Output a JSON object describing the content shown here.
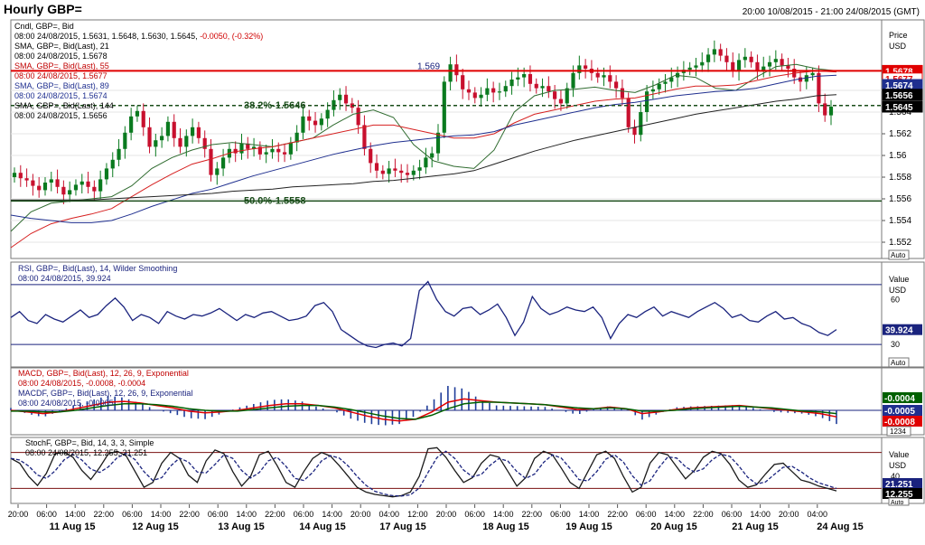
{
  "window": {
    "title": "Hourly GBP=",
    "time_range": "20:00 10/08/2015 - 21:00 24/08/2015 (GMT)"
  },
  "colors": {
    "candle_up": "#0a7a1f",
    "candle_down": "#c8102e",
    "sma21": "#2f6b2f",
    "sma55": "#d62020",
    "sma89": "#1f2f8f",
    "sma144": "#222222",
    "rsi": "#1a237e",
    "macd": "#e00000",
    "macdf": "#006000",
    "hist": "#1f3d99",
    "stoch_k": "#1a1a1a",
    "stoch_d": "#1a237e",
    "resistance": "#e00000"
  },
  "price_panel": {
    "legend": [
      {
        "text": "Cndl, GBP=, Bid",
        "color": "#000000"
      },
      {
        "text": "08:00 24/08/2015, 1.5631, 1.5648, 1.5630, 1.5645, ",
        "color": "#000000",
        "extra": "-0.0050, (-0.32%)",
        "extra_color": "#d00000"
      },
      {
        "text": "SMA, GBP=, Bid(Last), 21",
        "color": "#000000"
      },
      {
        "text": "08:00 24/08/2015, 1.5678",
        "color": "#000000"
      },
      {
        "text": "SMA, GBP=, Bid(Last), 55",
        "color": "#c00000"
      },
      {
        "text": "08:00 24/08/2015, 1.5677",
        "color": "#c00000"
      },
      {
        "text": "SMA, GBP=, Bid(Last), 89",
        "color": "#1f2f8f"
      },
      {
        "text": "08:00 24/08/2015, 1.5674",
        "color": "#1f2f8f"
      },
      {
        "text": "SMA, GBP=, Bid(Last), 144",
        "color": "#000000"
      },
      {
        "text": "08:00 24/08/2015, 1.5656",
        "color": "#000000"
      }
    ],
    "axis_header": [
      "Price",
      "USD"
    ],
    "ticks": [
      "1.566",
      "1.564",
      "1.562",
      "1.56",
      "1.558",
      "1.556",
      "1.554",
      "1.552"
    ],
    "ylim": [
      1.5505,
      1.5725
    ],
    "resistance": {
      "value": 1.5678,
      "label": "1.569"
    },
    "fib_382": {
      "value": 1.5646,
      "label": "38.2%-1.5646"
    },
    "fib_500": {
      "value": 1.5558,
      "label": "50.0%-1.5558"
    },
    "value_labels": [
      {
        "text": "1.5678",
        "value": 1.5678,
        "bg": "#e00000",
        "fg": "#ffffff"
      },
      {
        "text": "1.5677",
        "value": 1.5671,
        "bg": "#ffffff",
        "fg": "#e00000"
      },
      {
        "text": "1.5674",
        "value": 1.5665,
        "bg": "#1f2f8f",
        "fg": "#ffffff"
      },
      {
        "text": "1.5656",
        "value": 1.5656,
        "bg": "#000000",
        "fg": "#ffffff"
      },
      {
        "text": "1.5645",
        "value": 1.5645,
        "bg": "#000000",
        "fg": "#ffffff"
      }
    ],
    "auto": "Auto"
  },
  "rsi_panel": {
    "legend": [
      {
        "text": "RSI, GBP=, Bid(Last), 14, Wilder Smoothing",
        "color": "#1a237e"
      },
      {
        "text": "08:00 24/08/2015, 39.924",
        "color": "#1a237e"
      }
    ],
    "axis_header": [
      "Value",
      "USD"
    ],
    "ticks": [
      "60",
      "30"
    ],
    "ylim": [
      15,
      85
    ],
    "levels": [
      70,
      30
    ],
    "value_label": {
      "text": "39.924",
      "value": 39.924
    },
    "auto": "Auto"
  },
  "macd_panel": {
    "legend": [
      {
        "text": "MACD, GBP=, Bid(Last), 12, 26, 9, Exponential",
        "color": "#c00000"
      },
      {
        "text": "08:00 24/08/2015, -0.0008, -0.0004",
        "color": "#c00000"
      },
      {
        "text": "MACDF, GBP=, Bid(Last), 12, 26, 9, Exponential",
        "color": "#1a237e"
      },
      {
        "text": "08:00 24/08/2015, -0.0005",
        "color": "#1a237e"
      }
    ],
    "value_labels": [
      {
        "text": "-0.0004",
        "bg": "#006000",
        "fg": "#ffffff"
      },
      {
        "text": "-0.0005",
        "bg": "#1f2f8f",
        "fg": "#ffffff"
      },
      {
        "text": "-0.0008",
        "bg": "#e00000",
        "fg": "#ffffff"
      }
    ],
    "scale": "1234"
  },
  "stoch_panel": {
    "legend": [
      {
        "text": "StochF, GBP=, Bid, 14, 3, 3, Simple",
        "color": "#000000"
      },
      {
        "text": "08:00 24/08/2015, 12.255, 21.251",
        "color": "#000000"
      }
    ],
    "axis_header": [
      "Value",
      "USD"
    ],
    "ticks": [
      "40"
    ],
    "ylim": [
      -5,
      105
    ],
    "levels": [
      80,
      20
    ],
    "value_labels": [
      {
        "text": "21.251",
        "bg": "#1a237e",
        "fg": "#ffffff"
      },
      {
        "text": "12.255",
        "bg": "#000000",
        "fg": "#ffffff"
      }
    ],
    "auto": "Auto"
  },
  "x_axis": {
    "time_ticks": [
      "20:00",
      "06:00",
      "14:00",
      "22:00",
      "06:00",
      "14:00",
      "22:00",
      "06:00",
      "14:00",
      "22:00",
      "06:00",
      "14:00",
      "20:00",
      "04:00",
      "12:00",
      "20:00",
      "06:00",
      "14:00",
      "22:00",
      "06:00",
      "14:00",
      "22:00",
      "06:00",
      "14:00",
      "22:00",
      "06:00",
      "14:00",
      "20:00",
      "04:00"
    ],
    "date_labels": [
      "11 Aug 15",
      "12 Aug 15",
      "13 Aug 15",
      "14 Aug 15",
      "17 Aug 15",
      "18 Aug 15",
      "19 Aug 15",
      "20 Aug 15",
      "21 Aug 15",
      "24 Aug 15"
    ]
  },
  "chart_data": {
    "type": "line",
    "title": "Hourly GBP=",
    "series": [
      {
        "name": "Cndl, GBP=, Bid",
        "kind": "candlestick",
        "close": [
          1.5584,
          1.5579,
          1.5577,
          1.5572,
          1.5568,
          1.5575,
          1.5578,
          1.5571,
          1.5564,
          1.5568,
          1.5573,
          1.5576,
          1.5571,
          1.5567,
          1.5578,
          1.5588,
          1.5596,
          1.5606,
          1.5621,
          1.5636,
          1.5641,
          1.5626,
          1.5608,
          1.5614,
          1.5618,
          1.5631,
          1.5616,
          1.5608,
          1.5618,
          1.5626,
          1.5616,
          1.5606,
          1.5582,
          1.5588,
          1.5598,
          1.5606,
          1.5602,
          1.5611,
          1.5606,
          1.5608,
          1.5601,
          1.5603,
          1.5606,
          1.5603,
          1.5601,
          1.5612,
          1.5621,
          1.5636,
          1.5632,
          1.5628,
          1.5634,
          1.5642,
          1.5651,
          1.5656,
          1.5648,
          1.5644,
          1.5628,
          1.5606,
          1.5593,
          1.5586,
          1.5583,
          1.5588,
          1.5586,
          1.5584,
          1.5582,
          1.5586,
          1.5589,
          1.5598,
          1.5602,
          1.5621,
          1.5668,
          1.5684,
          1.5674,
          1.5661,
          1.5658,
          1.5653,
          1.5656,
          1.5662,
          1.5658,
          1.5659,
          1.5664,
          1.567,
          1.5672,
          1.5675,
          1.5666,
          1.5662,
          1.5664,
          1.5659,
          1.5652,
          1.5648,
          1.5662,
          1.5676,
          1.5683,
          1.568,
          1.5676,
          1.5672,
          1.5674,
          1.5668,
          1.5662,
          1.5653,
          1.5626,
          1.5619,
          1.564,
          1.5659,
          1.5661,
          1.5666,
          1.5668,
          1.5672,
          1.5676,
          1.5679,
          1.5681,
          1.5683,
          1.5686,
          1.5693,
          1.5698,
          1.5692,
          1.5686,
          1.5678,
          1.5688,
          1.5691,
          1.5686,
          1.5678,
          1.5682,
          1.5686,
          1.5689,
          1.5683,
          1.568,
          1.5672,
          1.5668,
          1.5674,
          1.5676,
          1.5648,
          1.5637,
          1.5645
        ]
      },
      {
        "name": "SMA, GBP=, Bid(Last), 21",
        "values": [
          1.553,
          1.5548,
          1.5556,
          1.5558,
          1.556,
          1.5562,
          1.5572,
          1.5588,
          1.5598,
          1.5605,
          1.561,
          1.5612,
          1.561,
          1.5608,
          1.5612,
          1.5616,
          1.5628,
          1.5638,
          1.5642,
          1.5635,
          1.561,
          1.5595,
          1.559,
          1.5588,
          1.5605,
          1.564,
          1.5655,
          1.566,
          1.5661,
          1.5663,
          1.566,
          1.5658,
          1.5665,
          1.5674,
          1.5672,
          1.5662,
          1.566,
          1.5672,
          1.5682,
          1.5684,
          1.568,
          1.5678
        ]
      },
      {
        "name": "SMA, GBP=, Bid(Last), 55",
        "values": [
          1.5515,
          1.5528,
          1.5537,
          1.5542,
          1.5546,
          1.5551,
          1.5562,
          1.5573,
          1.5583,
          1.5592,
          1.5597,
          1.5603,
          1.5606,
          1.5608,
          1.5612,
          1.5616,
          1.562,
          1.5624,
          1.5628,
          1.5628,
          1.5624,
          1.562,
          1.5616,
          1.5616,
          1.562,
          1.563,
          1.5638,
          1.5642,
          1.5646,
          1.565,
          1.5652,
          1.5653,
          1.5657,
          1.5661,
          1.5664,
          1.5664,
          1.5665,
          1.5669,
          1.5673,
          1.5676,
          1.5678,
          1.5677
        ]
      },
      {
        "name": "SMA, GBP=, Bid(Last), 89",
        "values": [
          1.5545,
          1.5542,
          1.554,
          1.5538,
          1.5538,
          1.554,
          1.5546,
          1.5553,
          1.5559,
          1.5565,
          1.5569,
          1.5575,
          1.5581,
          1.5586,
          1.5591,
          1.5596,
          1.5601,
          1.5605,
          1.5609,
          1.5612,
          1.5614,
          1.5616,
          1.5618,
          1.5619,
          1.5622,
          1.5628,
          1.5632,
          1.5636,
          1.564,
          1.5644,
          1.5647,
          1.5649,
          1.5652,
          1.5655,
          1.5657,
          1.5659,
          1.566,
          1.5662,
          1.5666,
          1.567,
          1.5673,
          1.5674
        ]
      },
      {
        "name": "SMA, GBP=, Bid(Last), 144",
        "values": [
          1.5559,
          1.5559,
          1.5559,
          1.5559,
          1.5559,
          1.556,
          1.5561,
          1.5562,
          1.5563,
          1.5564,
          1.5565,
          1.5567,
          1.5568,
          1.5569,
          1.5571,
          1.5572,
          1.5573,
          1.5574,
          1.5576,
          1.5577,
          1.5579,
          1.5581,
          1.5583,
          1.5586,
          1.5592,
          1.5598,
          1.5604,
          1.5609,
          1.5614,
          1.5618,
          1.5622,
          1.5626,
          1.563,
          1.5634,
          1.5638,
          1.5641,
          1.5644,
          1.5647,
          1.565,
          1.5652,
          1.5655,
          1.5656
        ]
      },
      {
        "name": "RSI, GBP=, Bid(Last), 14, Wilder Smoothing",
        "values": [
          48,
          52,
          46,
          44,
          50,
          47,
          45,
          49,
          53,
          48,
          50,
          56,
          61,
          55,
          46,
          50,
          48,
          44,
          52,
          49,
          47,
          50,
          49,
          51,
          54,
          50,
          46,
          50,
          48,
          51,
          52,
          49,
          46,
          47,
          49,
          56,
          58,
          52,
          40,
          36,
          32,
          29,
          28,
          30,
          31,
          29,
          34,
          66,
          72,
          60,
          52,
          49,
          54,
          55,
          50,
          53,
          57,
          48,
          36,
          45,
          62,
          54,
          50,
          52,
          55,
          53,
          52,
          55,
          48,
          34,
          44,
          50,
          48,
          52,
          55,
          49,
          52,
          50,
          48,
          52,
          55,
          58,
          54,
          48,
          50,
          46,
          45,
          49,
          52,
          47,
          48,
          44,
          42,
          38,
          36,
          40
        ]
      },
      {
        "name": "MACD, GBP=, Bid(Last), 12, 26, 9, Exponential",
        "values": [
          0.0,
          -0.0002,
          -0.0004,
          -0.0002,
          0.0002,
          0.0006,
          0.001,
          0.0011,
          0.0009,
          0.0006,
          0.0003,
          -0.0001,
          -0.0003,
          -0.0002,
          0.0,
          0.0003,
          0.0006,
          0.0008,
          0.0008,
          0.0006,
          0.0003,
          -0.0002,
          -0.0007,
          -0.0011,
          -0.0013,
          -0.0011,
          -0.0002,
          0.001,
          0.0014,
          0.0012,
          0.001,
          0.0009,
          0.0008,
          0.0007,
          0.0004,
          0.0001,
          0.0002,
          0.0004,
          0.0002,
          -0.0004,
          -0.0002,
          0.0001,
          0.0003,
          0.0004,
          0.0005,
          0.0006,
          0.0004,
          0.0002,
          0.0,
          -0.0002,
          -0.0004,
          -0.0008
        ]
      },
      {
        "name": "MACDF, GBP=, Bid(Last), 12, 26, 9, Exponential",
        "values": [
          -0.0001,
          -0.0001,
          -0.0002,
          -0.0002,
          0.0,
          0.0003,
          0.0006,
          0.0008,
          0.0008,
          0.0007,
          0.0005,
          0.0002,
          0.0,
          -0.0001,
          -0.0001,
          0.0001,
          0.0003,
          0.0005,
          0.0006,
          0.0006,
          0.0004,
          0.0001,
          -0.0003,
          -0.0007,
          -0.001,
          -0.0011,
          -0.0006,
          0.0002,
          0.0008,
          0.001,
          0.001,
          0.0009,
          0.0008,
          0.0007,
          0.0005,
          0.0003,
          0.0002,
          0.0003,
          0.0002,
          -0.0001,
          -0.0001,
          0.0,
          0.0002,
          0.0003,
          0.0004,
          0.0005,
          0.0004,
          0.0003,
          0.0001,
          -0.0001,
          -0.0002,
          -0.0004
        ]
      },
      {
        "name": "StochF, GBP=, Bid, 14, 3, 3, Simple",
        "values": [
          70,
          62,
          40,
          25,
          45,
          78,
          80,
          72,
          50,
          35,
          55,
          78,
          82,
          74,
          48,
          22,
          30,
          62,
          80,
          70,
          42,
          30,
          66,
          84,
          78,
          48,
          24,
          40,
          76,
          82,
          58,
          30,
          22,
          48,
          70,
          80,
          74,
          58,
          40,
          22,
          14,
          10,
          8,
          6,
          8,
          14,
          40,
          86,
          88,
          72,
          50,
          30,
          38,
          62,
          76,
          72,
          48,
          24,
          38,
          70,
          82,
          76,
          54,
          30,
          20,
          48,
          76,
          82,
          70,
          40,
          14,
          22,
          62,
          80,
          76,
          56,
          36,
          50,
          72,
          82,
          78,
          60,
          34,
          22,
          26,
          44,
          60,
          62,
          48,
          34,
          30,
          24,
          20,
          16
        ]
      }
    ]
  }
}
